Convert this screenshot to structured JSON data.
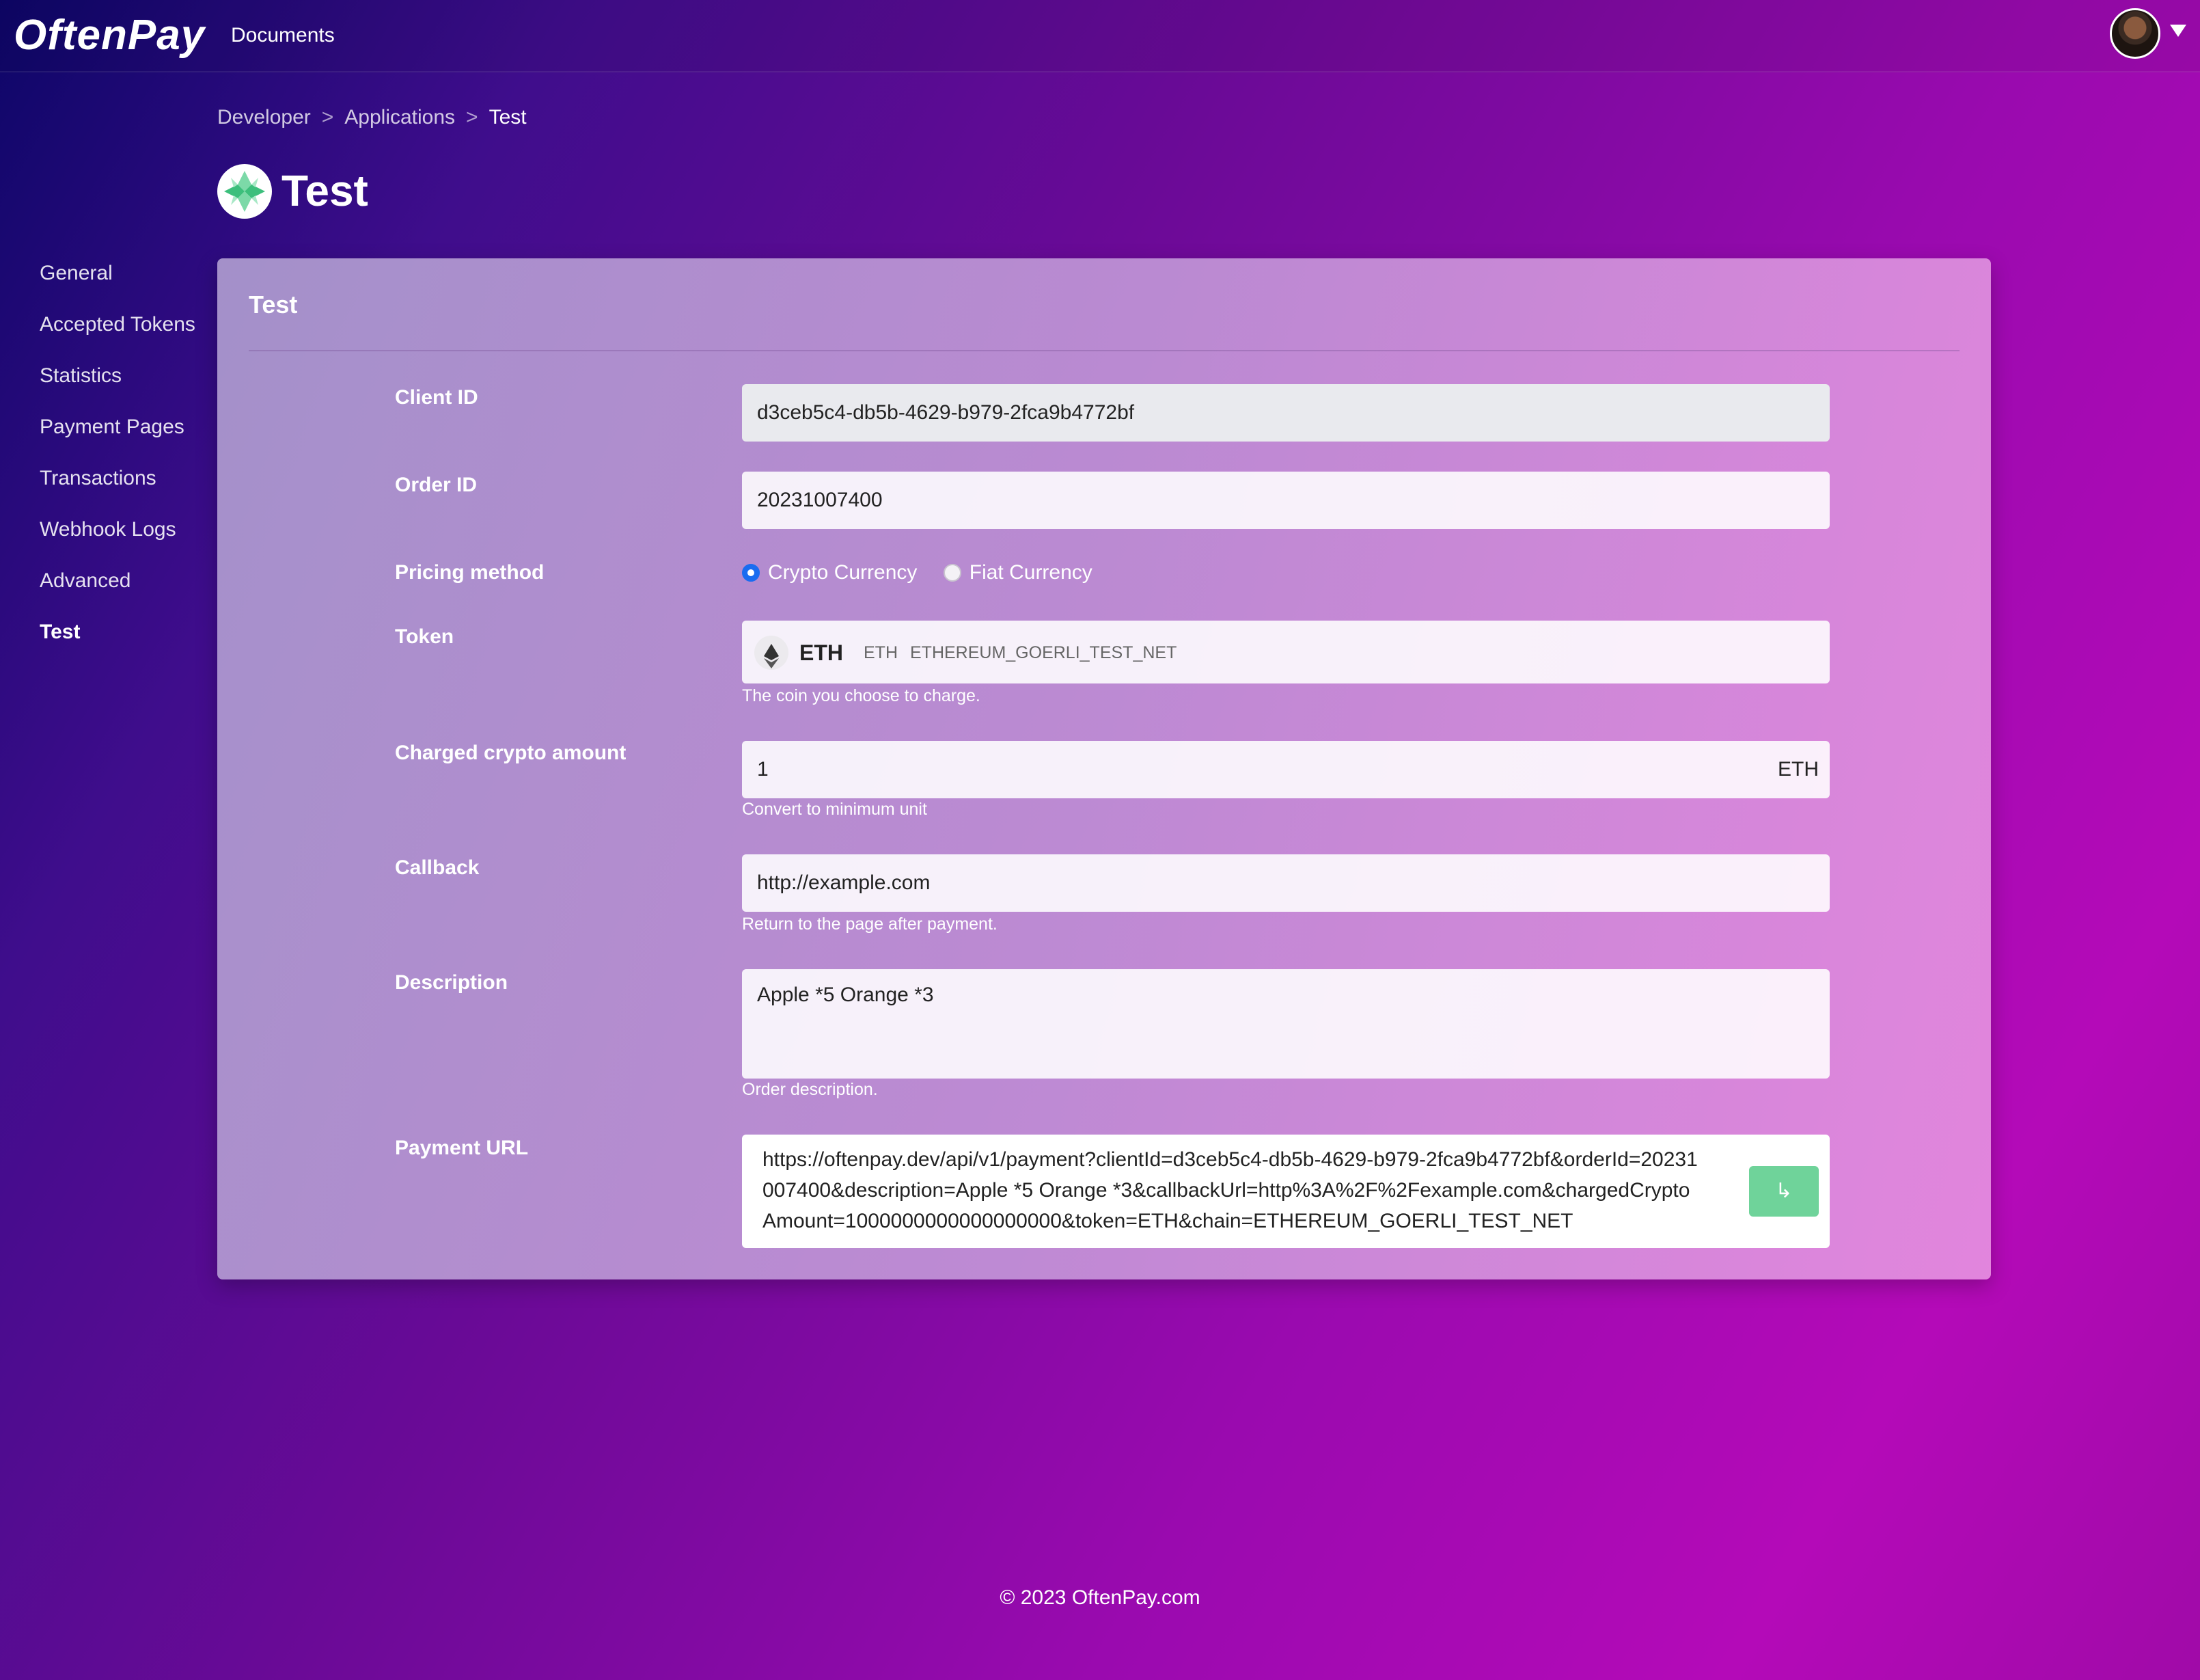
{
  "header": {
    "logo": "OftenPay",
    "nav_documents": "Documents"
  },
  "breadcrumb": {
    "items": [
      "Developer",
      "Applications",
      "Test"
    ],
    "separator": ">"
  },
  "page": {
    "title": "Test"
  },
  "sidebar": {
    "items": [
      {
        "label": "General"
      },
      {
        "label": "Accepted Tokens"
      },
      {
        "label": "Statistics"
      },
      {
        "label": "Payment Pages"
      },
      {
        "label": "Transactions"
      },
      {
        "label": "Webhook Logs"
      },
      {
        "label": "Advanced"
      },
      {
        "label": "Test"
      }
    ],
    "active": "Test"
  },
  "card": {
    "title": "Test",
    "client_id": {
      "label": "Client ID",
      "value": "d3ceb5c4-db5b-4629-b979-2fca9b4772bf"
    },
    "order_id": {
      "label": "Order ID",
      "value": "20231007400"
    },
    "pricing": {
      "label": "Pricing method",
      "options": [
        "Crypto Currency",
        "Fiat Currency"
      ],
      "selected": "Crypto Currency"
    },
    "token": {
      "label": "Token",
      "name": "ETH",
      "symbol": "ETH",
      "chain": "ETHEREUM_GOERLI_TEST_NET",
      "help": "The coin you choose to charge."
    },
    "amount": {
      "label": "Charged crypto amount",
      "value": "1",
      "unit": "ETH",
      "help": "Convert to minimum unit"
    },
    "callback": {
      "label": "Callback",
      "value": "http://example.com",
      "help": "Return to the page after payment."
    },
    "description": {
      "label": "Description",
      "value": "Apple *5 Orange *3",
      "help": "Order description."
    },
    "payment_url": {
      "label": "Payment URL",
      "value": "https://oftenpay.dev/api/v1/payment?clientId=d3ceb5c4-db5b-4629-b979-2fca9b4772bf&orderId=20231007400&description=Apple *5 Orange *3&callbackUrl=http%3A%2F%2Fexample.com&chargedCryptoAmount=1000000000000000000&token=ETH&chain=ETHEREUM_GOERLI_TEST_NET",
      "open_icon": "open-link-icon"
    }
  },
  "footer": {
    "text": "© 2023 OftenPay.com"
  },
  "colors": {
    "radio_selected": "#1a6cf0",
    "open_button": "#6fd39a"
  }
}
